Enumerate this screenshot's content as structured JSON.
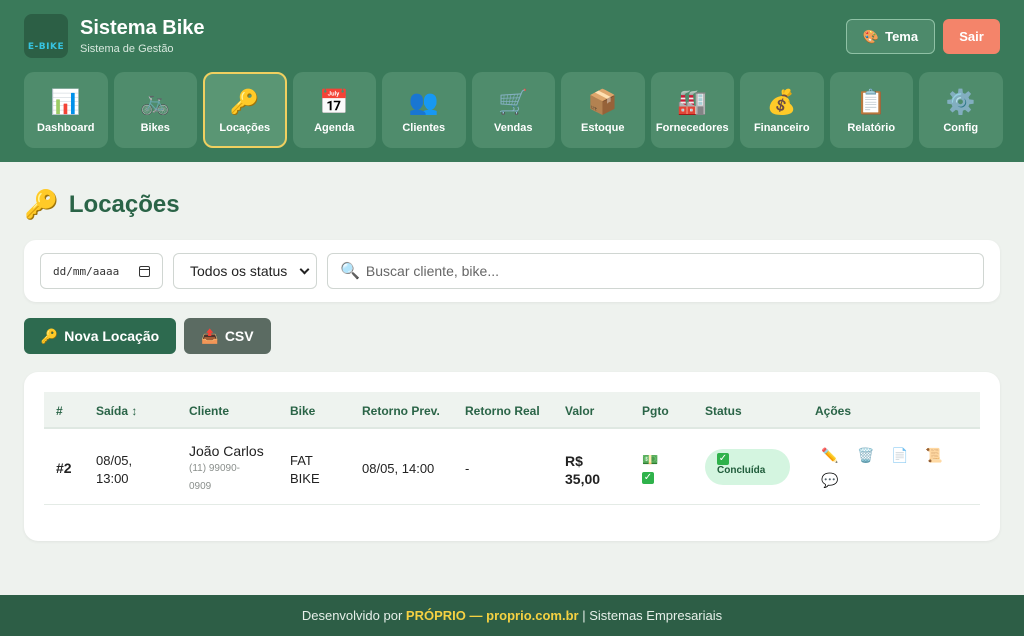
{
  "header": {
    "logo_text": "E-BIKE",
    "title": "Sistema Bike",
    "subtitle": "Sistema de Gestão",
    "theme_label": "Tema",
    "exit_label": "Sair"
  },
  "nav": [
    {
      "label": "Dashboard",
      "icon": "chart-icon",
      "glyph": "📊"
    },
    {
      "label": "Bikes",
      "icon": "bicycle-icon",
      "glyph": "🚲"
    },
    {
      "label": "Locações",
      "icon": "key-icon",
      "glyph": "🔑"
    },
    {
      "label": "Agenda",
      "icon": "calendar-icon",
      "glyph": "📅"
    },
    {
      "label": "Clientes",
      "icon": "users-icon",
      "glyph": "👥"
    },
    {
      "label": "Vendas",
      "icon": "cart-icon",
      "glyph": "🛒"
    },
    {
      "label": "Estoque",
      "icon": "box-icon",
      "glyph": "📦"
    },
    {
      "label": "Fornecedores",
      "icon": "factory-icon",
      "glyph": "🏭"
    },
    {
      "label": "Financeiro",
      "icon": "money-bag-icon",
      "glyph": "💰"
    },
    {
      "label": "Relatório",
      "icon": "clipboard-icon",
      "glyph": "📋"
    },
    {
      "label": "Config",
      "icon": "gear-icon",
      "glyph": "⚙️"
    }
  ],
  "active_nav": "Locações",
  "page": {
    "title": "Locações",
    "title_icon": "🔑"
  },
  "filters": {
    "date_placeholder": "dd/mm/aaaa",
    "status_selected": "Todos os status",
    "search_placeholder": "Buscar cliente, bike..."
  },
  "actions": {
    "new_label": "Nova Locação",
    "csv_label": "CSV"
  },
  "table": {
    "columns": [
      "#",
      "Saída ↕",
      "Cliente",
      "Bike",
      "Retorno Prev.",
      "Retorno Real",
      "Valor",
      "Pgto",
      "Status",
      "Ações"
    ],
    "rows": [
      {
        "id": "#2",
        "saida_date": "08/05,",
        "saida_time": "13:00",
        "cliente": "João Carlos",
        "telefone_1": "(11) 99090-",
        "telefone_2": "0909",
        "bike_1": "FAT",
        "bike_2": "BIKE",
        "retorno_prev": "08/05, 14:00",
        "retorno_real": "-",
        "valor_1": "R$",
        "valor_2": "35,00",
        "status": "Concluída"
      }
    ]
  },
  "footer": {
    "prefix": "Desenvolvido por",
    "brand": "PRÓPRIO",
    "sep": "—",
    "site": "proprio.com.br",
    "suffix": "| Sistemas Empresariais"
  },
  "colors": {
    "header": "#3a7a5a",
    "primary": "#2d6a4f",
    "accent": "#f5d142",
    "exit": "#f4846a"
  }
}
